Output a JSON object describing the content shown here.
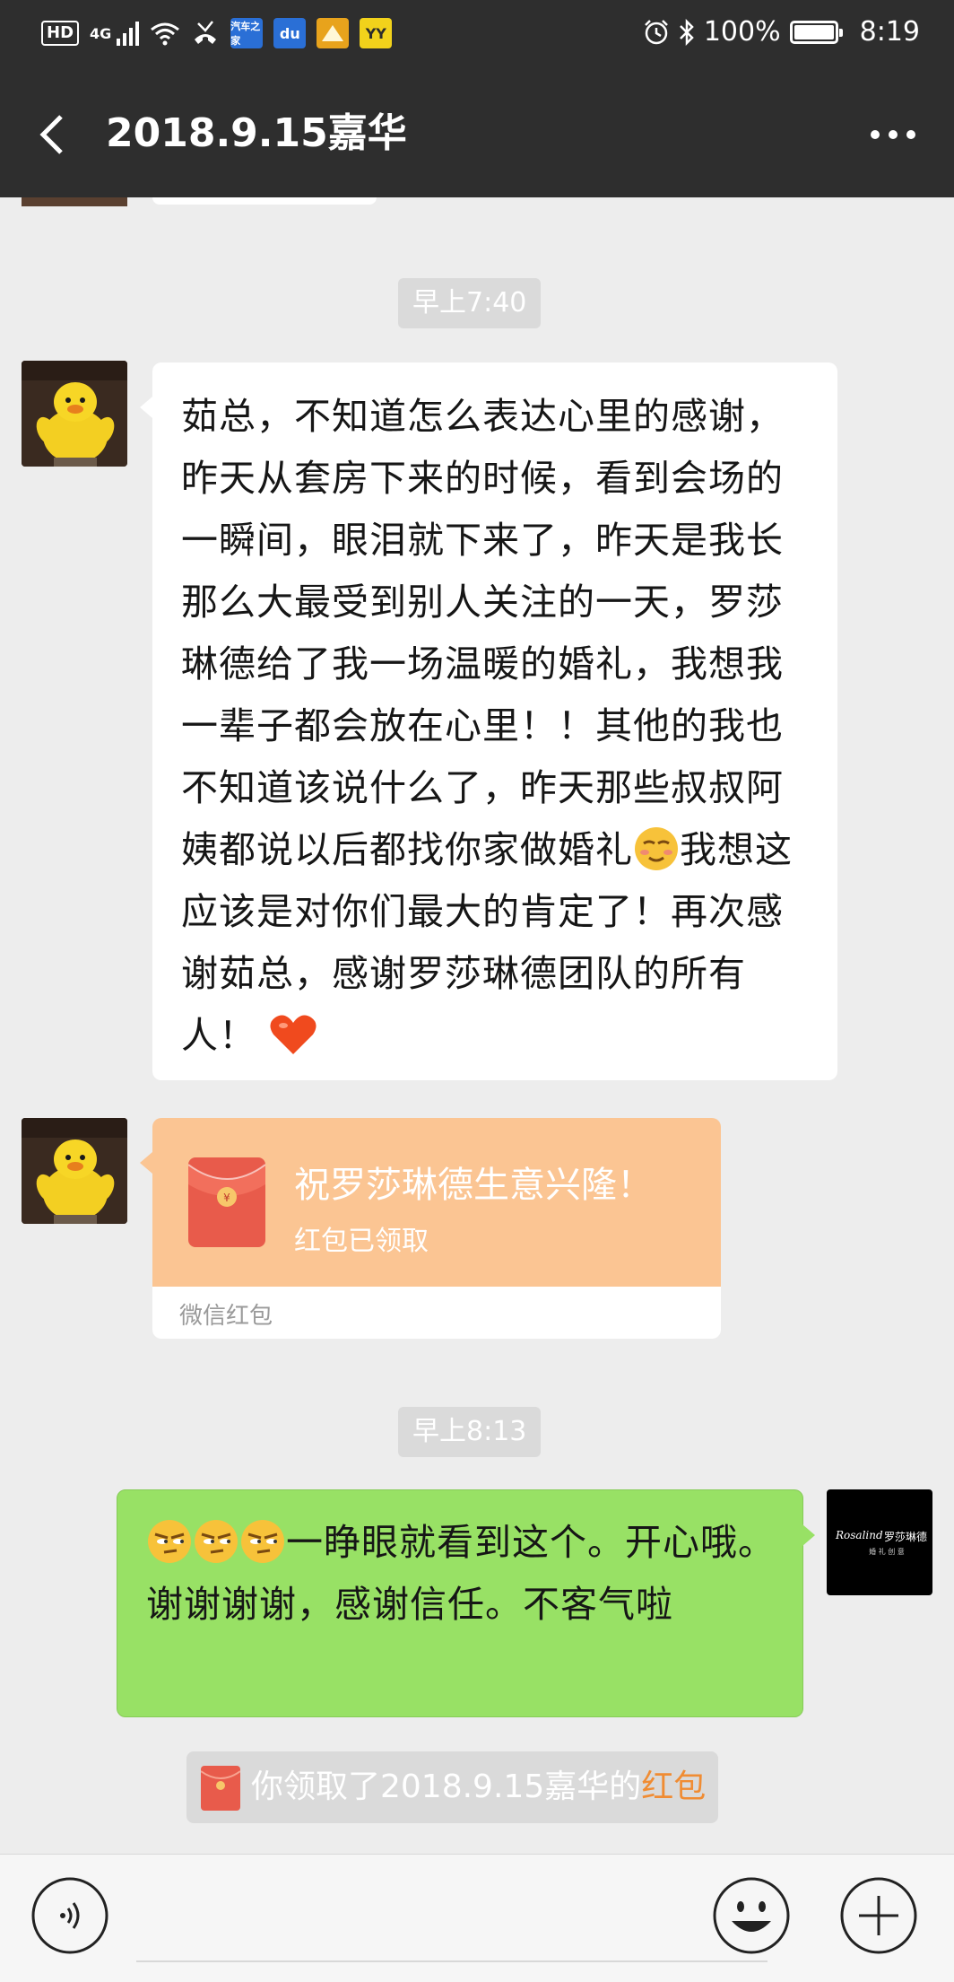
{
  "status_bar": {
    "left_icons": [
      "hd-icon",
      "4g-signal-icon",
      "wifi-icon",
      "missed-call-icon",
      "autohome-app-icon",
      "baidu-app-icon",
      "folder-app-icon",
      "yy-app-icon"
    ],
    "hd": "HD",
    "network": "4G",
    "app_label_autohome": "汽车之家",
    "app_label_baidu": "du",
    "app_label_yy": "YY",
    "battery": "100%",
    "time": "8:19"
  },
  "header": {
    "title": "2018.9.15嘉华"
  },
  "messages": {
    "timestamp_1": "早上7:40",
    "text_1": "茹总，不知道怎么表达心里的感谢，昨天从套房下来的时候，看到会场的一瞬间，眼泪就下来了，昨天是我长那么大最受到别人关注的一天，罗莎琳德给了我一场温暖的婚礼，我想我一辈子都会放在心里！！其他的我也不知道该说什么了，昨天那些叔叔阿姨都说以后都找你家做婚礼",
    "text_1_tail": "我想这应该是对你们最大的肯定了！再次感谢茹总，感谢罗莎琳德团队的所有人！",
    "red_packet": {
      "title": "祝罗莎琳德生意兴隆！",
      "status": "红包已领取",
      "footer": "微信红包"
    },
    "timestamp_2": "早上8:13",
    "text_2": "一睁眼就看到这个。开心哦。谢谢谢谢，感谢信任。不客气啦",
    "system_notice": {
      "text": "你领取了2018.9.15嘉华的",
      "link": "红包"
    },
    "logo_text": "罗莎琳德",
    "logo_sub": "婚 礼 创 意",
    "logo_script": "Rosalind"
  },
  "colors": {
    "header_bg": "#2e2e2e",
    "chat_bg": "#ededed",
    "green_bubble": "#98e165",
    "red_packet": "#fbc593",
    "link_orange": "#f08c33"
  }
}
